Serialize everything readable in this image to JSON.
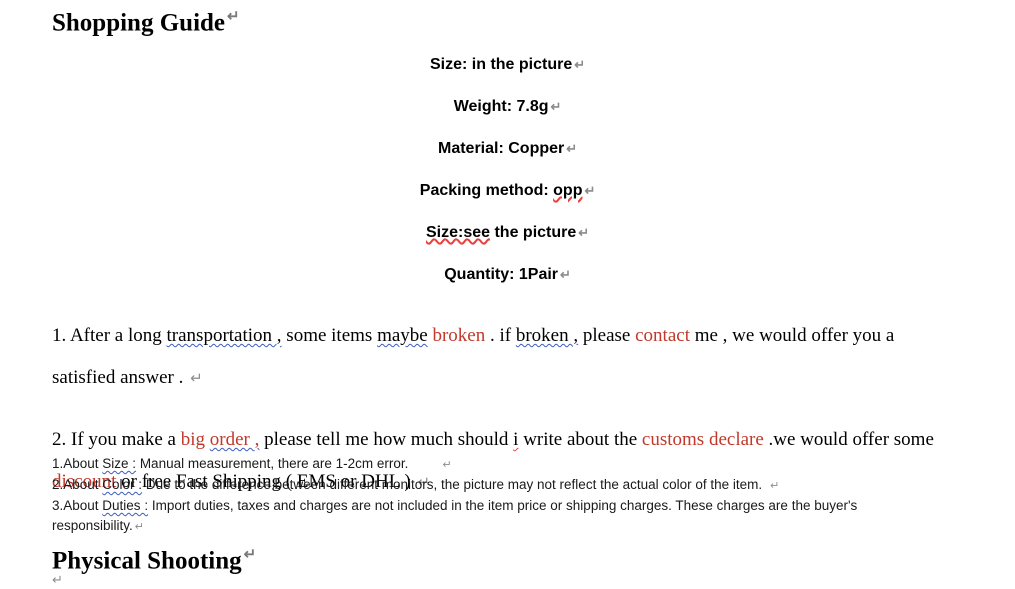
{
  "document": {
    "headings": {
      "shopping_guide": "Shopping Guide",
      "physical_shooting": "Physical Shooting"
    },
    "specs": [
      {
        "label": "Size:",
        "value": "in the picture",
        "full": "Size: in the picture"
      },
      {
        "label": "Weight:",
        "value": "7.8g",
        "full": "Weight: 7.8g"
      },
      {
        "label": "Material:",
        "value": "Copper",
        "full": "Material: Copper"
      },
      {
        "label": "Packing method:",
        "value": "opp",
        "full": "Packing method: opp"
      },
      {
        "label": "Size:",
        "value": "see the picture",
        "full": "Size:see the picture"
      },
      {
        "label": "Quantity:",
        "value": "1Pair",
        "full": "Quantity: 1Pair"
      }
    ],
    "spec_parts": {
      "packing_prefix": "Packing method: ",
      "packing_flagged": "opp",
      "size_flagged": "Size:see",
      "size_rest": " the picture"
    },
    "paragraph_1": {
      "number": "1. ",
      "t1": "After a long ",
      "flag1": "transportation ,",
      "t2": " some items ",
      "flag2": "maybe",
      "t3": " ",
      "red1": "broken",
      "t4": " . if ",
      "flag3": "broken ,",
      "t5": " please ",
      "red2": "contact",
      "t6": " me , we would offer you a satisfied answer . ",
      "plain": "1. After a long transportation , some items maybe broken . if broken , please contact me , we would offer you a satisfied answer ."
    },
    "paragraph_2": {
      "number": "2. ",
      "t1": "If you make a ",
      "red1": "big ",
      "red1b": "order ,",
      "t2": " please tell me how much should ",
      "flag1": "i",
      "t3": " write about the ",
      "red2": "customs declare",
      "t4": " .we would offer some ",
      "red3": "discount",
      "t5": " or free Fast Shipping ( EMS or DHL ) ",
      "plain": "2. If you make a big order , please tell me how much should i write about the customs declare .we would offer some discount or free Fast Shipping ( EMS or DHL )"
    },
    "notes": [
      {
        "number": "1.",
        "prefix": "About ",
        "flagged": "Size :",
        "text": " Manual measurement, there are 1-2cm error.",
        "plain": "1.About Size : Manual measurement, there are 1-2cm error."
      },
      {
        "number": "2.",
        "prefix": "About ",
        "flagged": "Color :",
        "text": " Due to the difference between different monitors, the picture may not reflect the actual color of the item.",
        "plain": "2.About Color : Due to the difference between different monitors, the picture may not reflect the actual color of the item."
      },
      {
        "number": "3.",
        "prefix": "About ",
        "flagged": "Duties :",
        "text": " Import duties, taxes and charges are not included in the item price or shipping charges. These charges are the buyer's responsibility.",
        "plain": "3.About Duties : Import duties, taxes and charges are not included in the item price or shipping charges. These charges are the buyer's responsibility."
      }
    ],
    "marks": {
      "pilcrow": "↵",
      "trailing_pilcrow": "↵"
    },
    "colors": {
      "highlight_red": "#c0392b",
      "spell_error_red": "#e8403a",
      "grammar_error_blue": "#3b5bbf",
      "pilcrow_gray": "#8c8c8c",
      "body_text": "#000000",
      "page_background": "#ffffff"
    }
  }
}
